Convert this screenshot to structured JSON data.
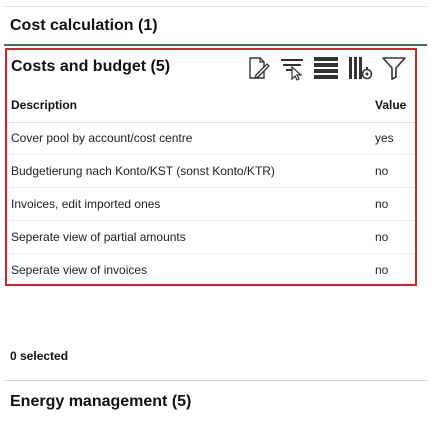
{
  "sections": {
    "cost_calculation": "Cost calculation (1)",
    "energy_management": "Energy management (5)"
  },
  "panel": {
    "title": "Costs and budget (5)",
    "columns": {
      "description": "Description",
      "value": "Value"
    },
    "rows": [
      {
        "description": "Cover pool by account/cost centre",
        "value": "yes"
      },
      {
        "description": "Budgetierung nach Konto/KST (sonst Konto/KTR)",
        "value": "no"
      },
      {
        "description": "Invoices, edit imported ones",
        "value": "no"
      },
      {
        "description": "Seperate view of partial amounts",
        "value": "no"
      },
      {
        "description": "Seperate view of invoices",
        "value": "no"
      }
    ],
    "toolbar_icons": [
      "edit-icon",
      "filter-select-icon",
      "rows-icon",
      "column-settings-icon",
      "filter-icon"
    ]
  },
  "footer": {
    "selected_text": "0 selected"
  },
  "colors": {
    "highlight_border": "#d9232a",
    "section_rule": "#2e7d4f"
  }
}
